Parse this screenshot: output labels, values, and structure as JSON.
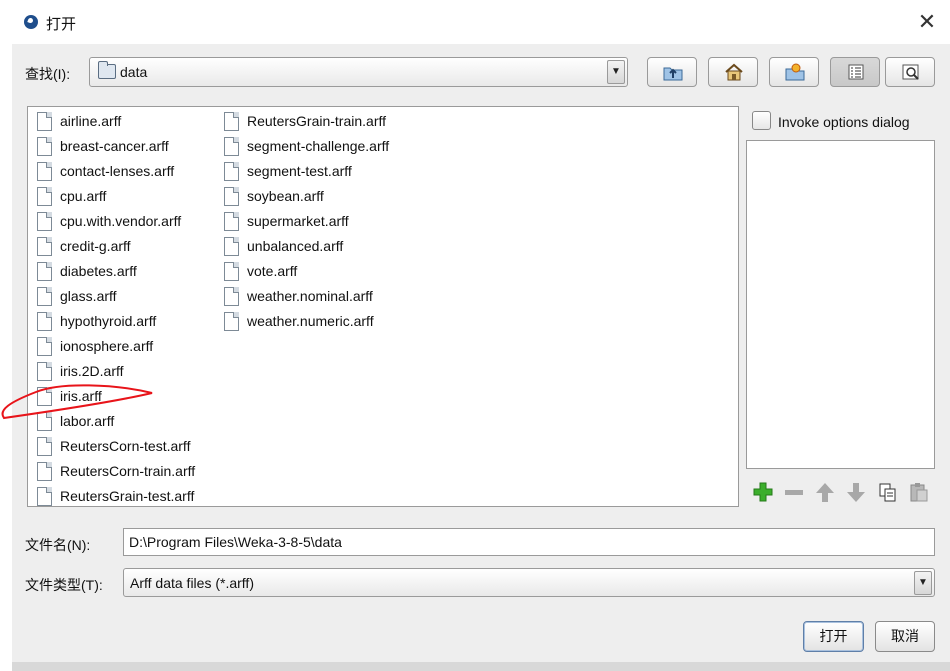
{
  "window": {
    "title": "打开",
    "close_glyph": "✕"
  },
  "look_in": {
    "label": "查找(I):",
    "value": "data"
  },
  "toolbar": {
    "icons": [
      "up-folder-icon",
      "home-icon",
      "new-folder-icon",
      "list-view-icon",
      "details-view-icon"
    ],
    "active_view": "list"
  },
  "files": {
    "column1": [
      "airline.arff",
      "breast-cancer.arff",
      "contact-lenses.arff",
      "cpu.arff",
      "cpu.with.vendor.arff",
      "credit-g.arff",
      "diabetes.arff",
      "glass.arff",
      "hypothyroid.arff",
      "ionosphere.arff",
      "iris.2D.arff",
      "iris.arff",
      "labor.arff",
      "ReutersCorn-test.arff",
      "ReutersCorn-train.arff",
      "ReutersGrain-test.arff"
    ],
    "column2": [
      "ReutersGrain-train.arff",
      "segment-challenge.arff",
      "segment-test.arff",
      "soybean.arff",
      "supermarket.arff",
      "unbalanced.arff",
      "vote.arff",
      "weather.nominal.arff",
      "weather.numeric.arff"
    ],
    "annotated_item": "iris.arff"
  },
  "options": {
    "invoke_label": "Invoke options dialog",
    "invoke_checked": false,
    "buttons": [
      "add-icon",
      "remove-icon",
      "move-up-icon",
      "move-down-icon",
      "copy-icon",
      "paste-icon"
    ]
  },
  "file_name": {
    "label": "文件名(N):",
    "value": "D:\\Program Files\\Weka-3-8-5\\data"
  },
  "file_type": {
    "label": "文件类型(T):",
    "value": "Arff data files (*.arff)"
  },
  "buttons": {
    "open": "打开",
    "cancel": "取消"
  },
  "colors": {
    "annotation": "#e8141a",
    "accent": "#1f4e8c",
    "add_green": "#3cae2c"
  }
}
